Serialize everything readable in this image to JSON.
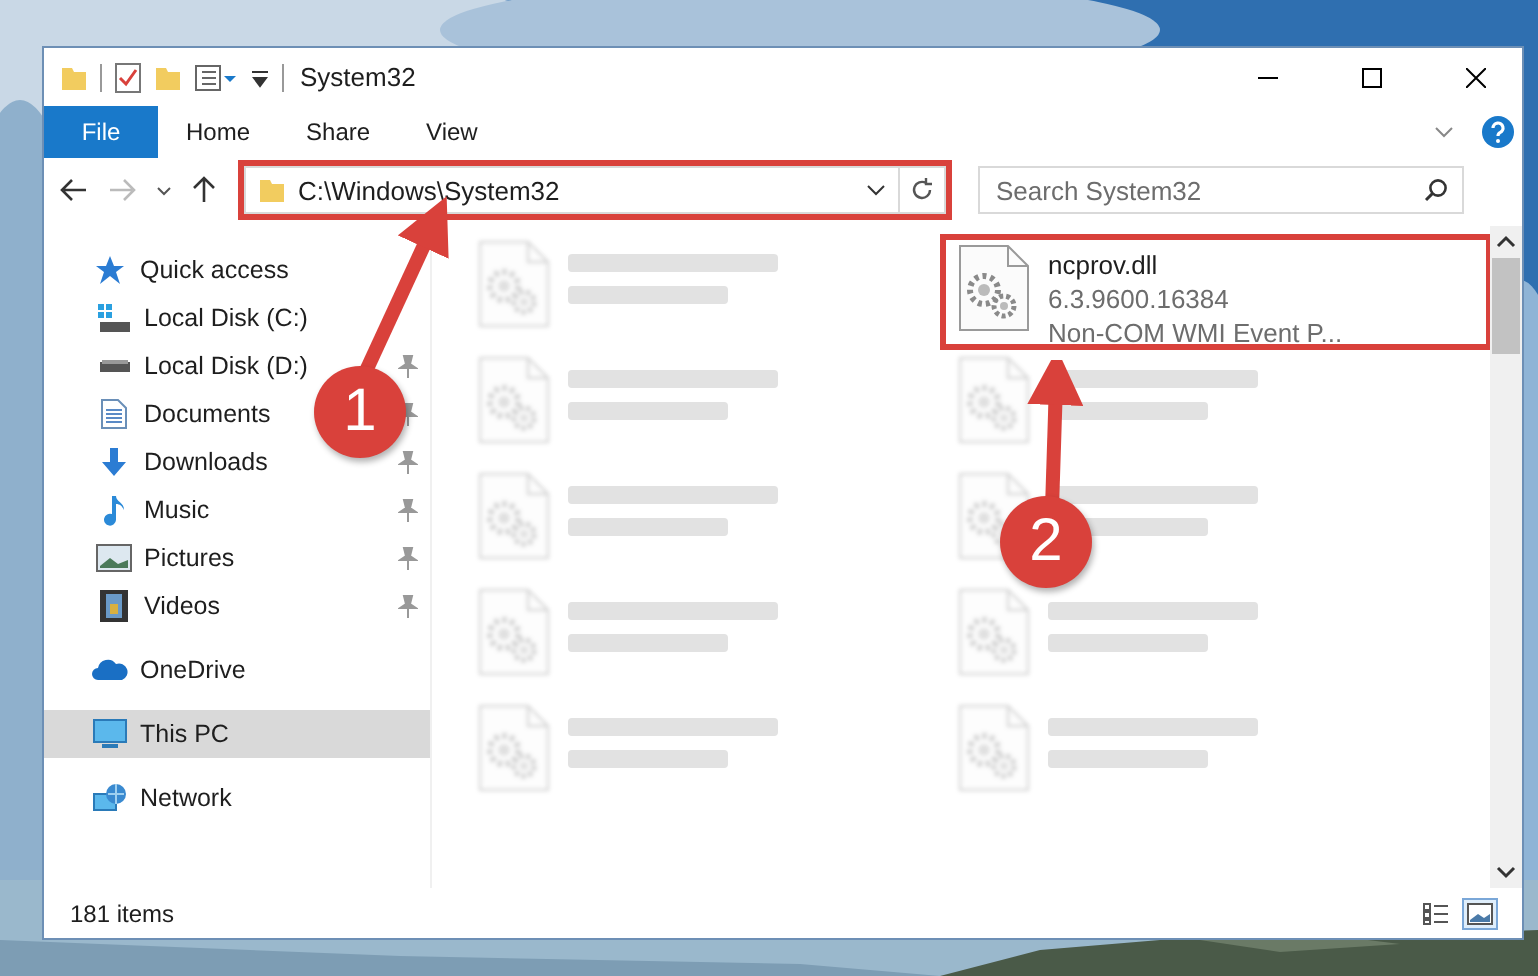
{
  "window": {
    "title": "System32"
  },
  "ribbon": {
    "tabs": [
      {
        "label": "File",
        "kind": "file",
        "selected": false
      },
      {
        "label": "Home",
        "kind": "tab",
        "selected": false
      },
      {
        "label": "Share",
        "kind": "tab",
        "selected": false
      },
      {
        "label": "View",
        "kind": "tab",
        "selected": false
      }
    ]
  },
  "address": {
    "path": "C:\\Windows\\System32",
    "highlighted": true
  },
  "search": {
    "placeholder": "Search System32"
  },
  "sidebar": {
    "items": [
      {
        "label": "Quick access",
        "kind": "quick",
        "selected": false,
        "children": [
          {
            "label": "Local Disk (C:)",
            "kind": "system-drive",
            "pinned": false
          },
          {
            "label": "Local Disk (D:)",
            "kind": "drive",
            "pinned": true
          },
          {
            "label": "Documents",
            "kind": "documents",
            "pinned": true
          },
          {
            "label": "Downloads",
            "kind": "downloads",
            "pinned": true
          },
          {
            "label": "Music",
            "kind": "music",
            "pinned": true
          },
          {
            "label": "Pictures",
            "kind": "pictures",
            "pinned": true
          },
          {
            "label": "Videos",
            "kind": "videos",
            "pinned": true
          }
        ]
      },
      {
        "label": "OneDrive",
        "kind": "cloud",
        "selected": false
      },
      {
        "label": "This PC",
        "kind": "pc",
        "selected": true
      },
      {
        "label": "Network",
        "kind": "network",
        "selected": false
      }
    ]
  },
  "files": [
    {
      "kind": "blurred"
    },
    {
      "kind": "file",
      "name": "ncprov.dll",
      "version": "6.3.9600.16384",
      "type": "Non-COM WMI Event P...",
      "highlighted": true
    },
    {
      "kind": "blurred"
    },
    {
      "kind": "blurred"
    },
    {
      "kind": "blurred"
    },
    {
      "kind": "blurred"
    },
    {
      "kind": "blurred"
    },
    {
      "kind": "blurred"
    },
    {
      "kind": "blurred"
    },
    {
      "kind": "blurred"
    }
  ],
  "status_bar": {
    "count": "181 items"
  },
  "view_buttons": [
    {
      "kind": "details",
      "selected": false
    },
    {
      "kind": "tiles",
      "selected": true
    }
  ],
  "annotations": [
    {
      "kind": "address",
      "number": "1"
    },
    {
      "kind": "file",
      "number": "2"
    }
  ]
}
